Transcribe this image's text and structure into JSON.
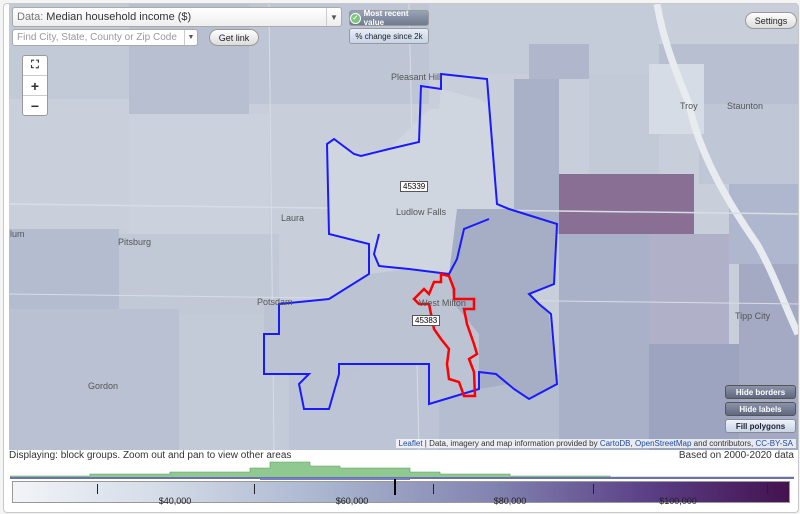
{
  "data_select": {
    "label": "Data:",
    "value": "Median household income ($)"
  },
  "search": {
    "placeholder": "Find City, State, County or Zip Code"
  },
  "buttons": {
    "get_link": "Get link",
    "most_recent": "Most recent value",
    "change_since": "% change since 2k",
    "settings": "Settings"
  },
  "zoom": {
    "fullscreen": "⛶",
    "in": "+",
    "out": "−"
  },
  "map_buttons": {
    "hide_borders": "Hide borders",
    "hide_labels": "Hide labels",
    "fill_polygons": "Fill polygons"
  },
  "places": [
    "Pleasant Hill",
    "Troy",
    "Staunton",
    "Laura",
    "Ludlow Falls",
    "Pitsburg",
    "Potsdam",
    "West Milton",
    "Tipp City",
    "Gordon",
    "lum"
  ],
  "zip_labels": [
    "45339",
    "45383"
  ],
  "attribution": {
    "leaflet": "Leaflet",
    "text1": " | Data, imagery and map information provided by ",
    "carto": "CartoDB",
    "sep": ", ",
    "osm": "OpenStreetMap",
    "text2": " and contributors, ",
    "license": "CC-BY-SA"
  },
  "status_text": "Displaying: block groups. Zoom out and pan to view other areas",
  "based_on": "Based on 2000-2020 data",
  "legend": {
    "labels": [
      "$40,000",
      "$60,000",
      "$80,000",
      "$100,000"
    ],
    "low_color": "#f2f4f8",
    "high_color": "#44124f"
  },
  "colors": {
    "border_blue": "#1a1aff",
    "border_red": "#ff0000",
    "hist_green": "#8fc98f"
  }
}
